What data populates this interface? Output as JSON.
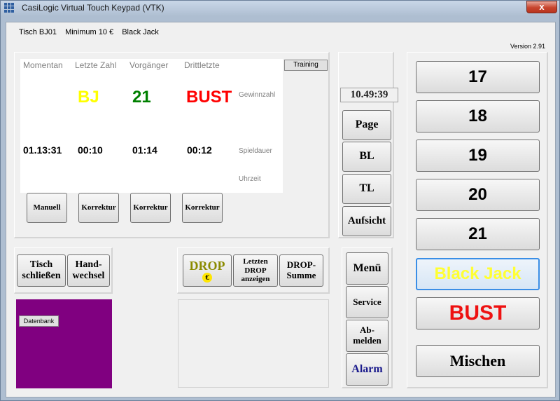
{
  "window": {
    "title": "CasiLogic Virtual Touch Keypad (VTK)",
    "close_glyph": "x"
  },
  "header": {
    "table": "Tisch BJ01",
    "minimum": "Minimum 10 €",
    "game": "Black Jack",
    "version": "Version 2.91"
  },
  "display": {
    "columns": [
      "Momentan",
      "Letzte Zahl",
      "Vorgänger",
      "Drittletzte"
    ],
    "last_number": "BJ",
    "previous": "21",
    "third_last": "BUST",
    "times": [
      "01.13:31",
      "00:10",
      "01:14",
      "00:12"
    ],
    "labels": {
      "winning_number": "Gewinnzahl",
      "game_duration": "Spieldauer",
      "time_of_day": "Uhrzeit"
    },
    "training": "Training",
    "colors": {
      "bj": "#ffff00",
      "previous": "#008000",
      "bust": "#ff0000"
    }
  },
  "correction_buttons": [
    "Manuell",
    "Korrektur",
    "Korrektur",
    "Korrektur"
  ],
  "clock": "10.49:39",
  "middle_buttons": {
    "page": "Page",
    "bl": "BL",
    "tl": "TL",
    "supervision": "Aufsicht"
  },
  "table_buttons": {
    "close_table": "Tisch schließen",
    "hand_change": "Hand-wechsel"
  },
  "drop_buttons": {
    "drop": "DROP",
    "drop_euro": "€",
    "show_last_drop": "Letzten DROP anzeigen",
    "drop_sum": "DROP-Summe"
  },
  "menu_buttons": {
    "menu": "Menü",
    "service": "Service",
    "logout": "Ab-melden",
    "alarm": "Alarm"
  },
  "database": "Datenbank",
  "number_buttons": [
    "17",
    "18",
    "19",
    "20",
    "21"
  ],
  "result_buttons": {
    "black_jack": "Black Jack",
    "bust": "BUST",
    "shuffle": "Mischen"
  }
}
